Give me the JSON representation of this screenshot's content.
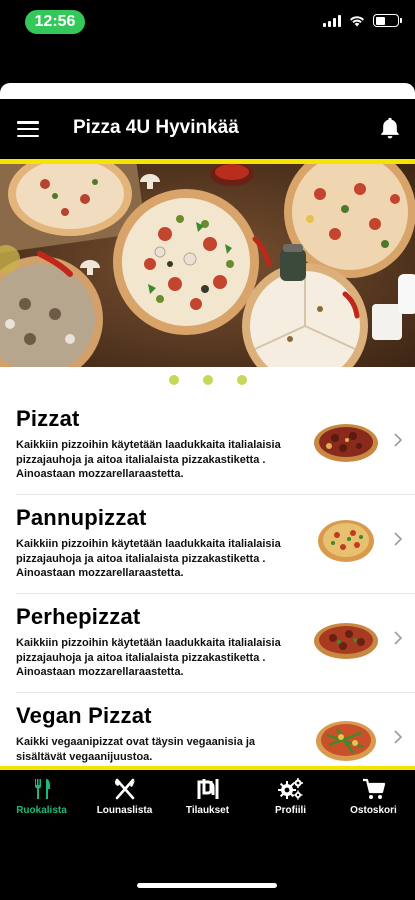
{
  "status_bar": {
    "time": "12:56",
    "battery_level": 0.45
  },
  "header": {
    "title": "Pizza 4U Hyvinkää"
  },
  "carousel": {
    "page_count": 3
  },
  "categories": [
    {
      "title": "Pizzat",
      "description": "Kaikkiin pizzoihin käytetään laadukkaita italialaisia pizzajauhoja ja aitoa italialaista pizzakastiketta . Ainoastaan mozzarellaraastetta."
    },
    {
      "title": "Pannupizzat",
      "description": "Kaikkiin pizzoihin käytetään laadukkaita italialaisia pizzajauhoja ja aitoa italialaista pizzakastiketta . Ainoastaan mozzarellaraastetta."
    },
    {
      "title": "Perhepizzat",
      "description": "Kaikkiin pizzoihin käytetään laadukkaita italialaisia pizzajauhoja ja aitoa italialaista pizzakastiketta . Ainoastaan mozzarellaraastetta."
    },
    {
      "title": "Vegan Pizzat",
      "description": "Kaikki vegaanipizzat ovat täysin vegaanisia ja sisältävät vegaanijuustoa."
    }
  ],
  "tabs": [
    {
      "label": "Ruokalista",
      "icon": "fork-knife-icon",
      "active": true
    },
    {
      "label": "Lounaslista",
      "icon": "cutlery-cross-icon",
      "active": false
    },
    {
      "label": "Tilaukset",
      "icon": "orders-icon",
      "active": false
    },
    {
      "label": "Profiili",
      "icon": "gears-icon",
      "active": false
    },
    {
      "label": "Ostoskori",
      "icon": "cart-icon",
      "active": false
    }
  ],
  "colors": {
    "accent_yellow": "#f5e400",
    "active_tab": "#1db97a",
    "dot": "#c8d65a",
    "time_pill": "#34c759"
  }
}
